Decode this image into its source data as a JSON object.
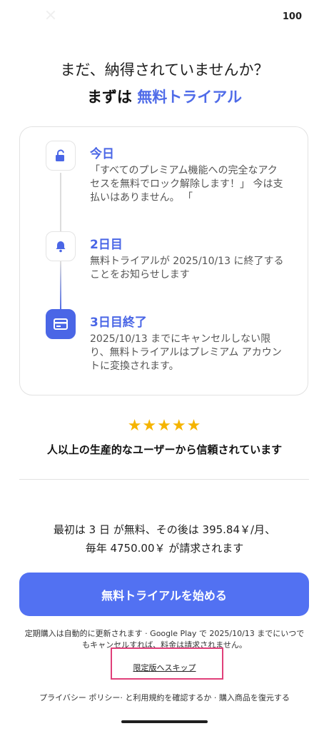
{
  "status": {
    "indicator": "100"
  },
  "header": {
    "question": "まだ、納得されていませんか？",
    "prefix": "まずは ",
    "highlight": "無料トライアル"
  },
  "timeline": [
    {
      "title": "今日",
      "icon": "unlock-icon",
      "description": "「すべてのプレミアム機能への完全なアクセスを無料でロック解除します！」 今は支払いはありません。 「"
    },
    {
      "title": "2日目",
      "icon": "bell-icon",
      "description": "無料トライアルが 2025/10/13 に終了することをお知らせします"
    },
    {
      "title": "3日目終了",
      "icon": "card-icon",
      "description": "2025/10/13 までにキャンセルしない限り、無料トライアルはプレミアム アカウントに変換されます。"
    }
  ],
  "rating": {
    "stars": "★★★★★",
    "trust_text": "人以上の生産的なユーザーから信頼されています"
  },
  "pricing": {
    "line1": "最初は 3 日 が無料、その後は 395.84￥/月、",
    "line2": "毎年 4750.00￥ が請求されます"
  },
  "cta_label": "無料トライアルを始める",
  "renewal_note": "定期購入は自動的に更新されます · Google Play で 2025/10/13 までにいつでもキャンセルすれば、料金は請求されません。",
  "skip_label": "限定版へスキップ",
  "footer": {
    "privacy": "プライバシー ポリシー",
    "sep1": "· と",
    "terms": "利用規約を確認するか",
    "sep2": " · ",
    "restore": "購入商品を復元する"
  },
  "colors": {
    "accent": "#4a66e6",
    "cta": "#5271f2",
    "star": "#f5b400",
    "highlight_box": "#e0407a"
  }
}
